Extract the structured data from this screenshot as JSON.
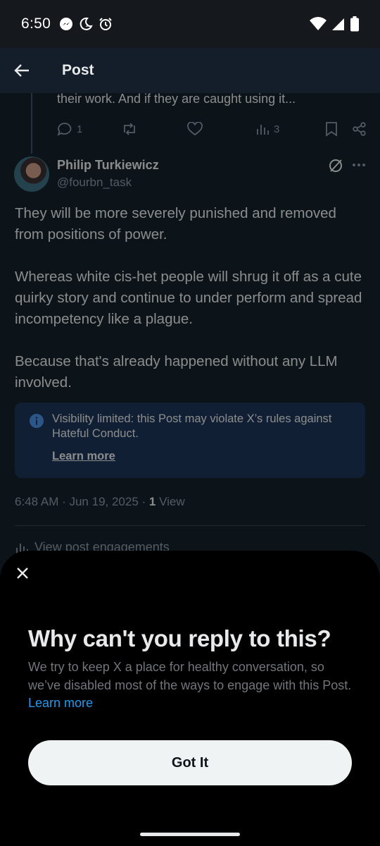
{
  "status_bar": {
    "time": "6:50",
    "left_icons": [
      "messenger-icon",
      "do-not-disturb-moon-icon",
      "alarm-icon"
    ],
    "right_icons": [
      "wifi-icon",
      "cell-signal-icon",
      "battery-icon"
    ]
  },
  "header": {
    "title": "Post"
  },
  "previous_post": {
    "text": "their work. And if they are caught using it...",
    "reply_count": "1",
    "view_count": "3"
  },
  "post": {
    "author_name": "Philip Turkiewicz",
    "author_handle": "@fourbn_task",
    "paragraphs": [
      "They will be more severely punished and removed from positions of power.",
      "Whereas white cis-het people will shrug it off as a cute quirky story and continue to under perform and spread incompetency like a plague.",
      "Because that's already happened without any LLM involved."
    ],
    "notice_text": "Visibility limited: this Post may violate X’s rules against Hateful Conduct.",
    "notice_link": "Learn more",
    "timestamp": "6:48 AM · Jun 19, 2025 · ",
    "views_num": "1",
    "views_label": " View",
    "engagements": "View post engagements"
  },
  "sheet": {
    "heading": "Why can't you reply to this?",
    "description": "We try to keep X a place for healthy conversation, so we’ve disabled most of the ways to engage with this Post.",
    "link": "Learn more",
    "button": "Got It"
  },
  "colors": {
    "accent": "#1d9bf0",
    "background": "#15202b",
    "notice_bg": "#1d3557",
    "sheet_bg": "#000000"
  }
}
